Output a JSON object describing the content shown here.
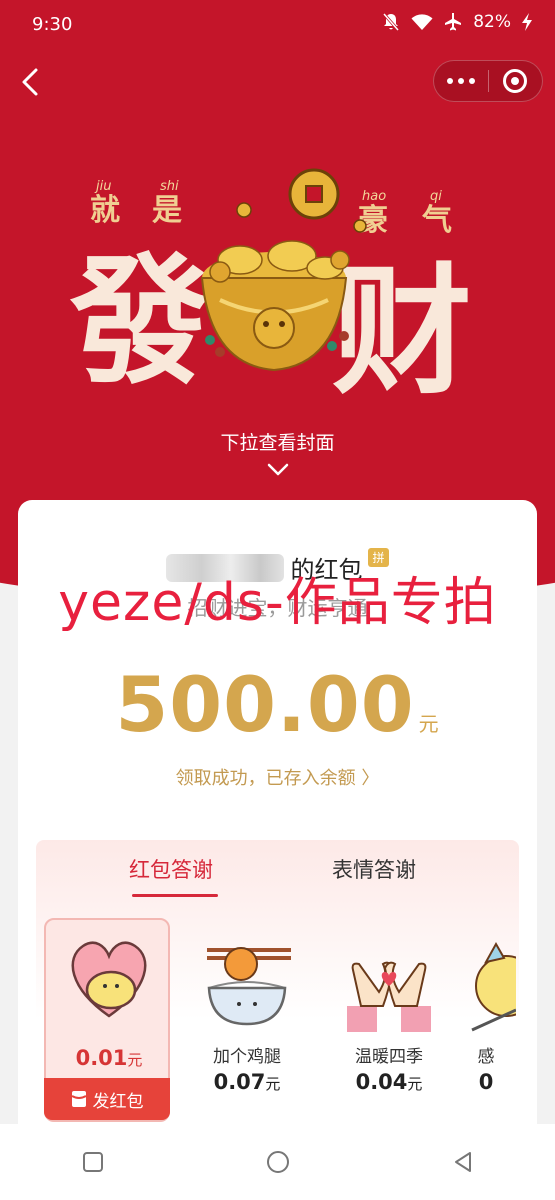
{
  "status": {
    "time": "9:30",
    "battery": "82%",
    "icons": [
      "mute-bell-icon",
      "wifi-icon",
      "airplane-icon",
      "charging-icon"
    ]
  },
  "cover": {
    "pinyin": [
      "jiu",
      "shi",
      "hao",
      "qi"
    ],
    "pinyin_words": [
      "就",
      "是",
      "豪",
      "气"
    ],
    "big_left": "發",
    "big_right": "财",
    "pull_hint": "下拉查看封面"
  },
  "envelope": {
    "sender_suffix": "的红包",
    "badge": "拼",
    "blessing": "招财进宝，财运亨通",
    "amount": "500.00",
    "unit": "元",
    "received": "领取成功，已存入余额 〉"
  },
  "watermark": "yeze/ds-作品专拍",
  "thanks": {
    "tabs": [
      {
        "label": "红包答谢",
        "active": true
      },
      {
        "label": "表情答谢",
        "active": false
      }
    ],
    "items": [
      {
        "name": "",
        "price": "0.01",
        "unit": "元",
        "selected": true,
        "button": "发红包"
      },
      {
        "name": "加个鸡腿",
        "price": "0.07",
        "unit": "元"
      },
      {
        "name": "温暖四季",
        "price": "0.04",
        "unit": "元"
      },
      {
        "name": "感",
        "price": "0",
        "unit": ""
      }
    ]
  },
  "colors": {
    "red": "#c4152a",
    "gold": "#d4a64e",
    "accent": "#d6283a"
  }
}
